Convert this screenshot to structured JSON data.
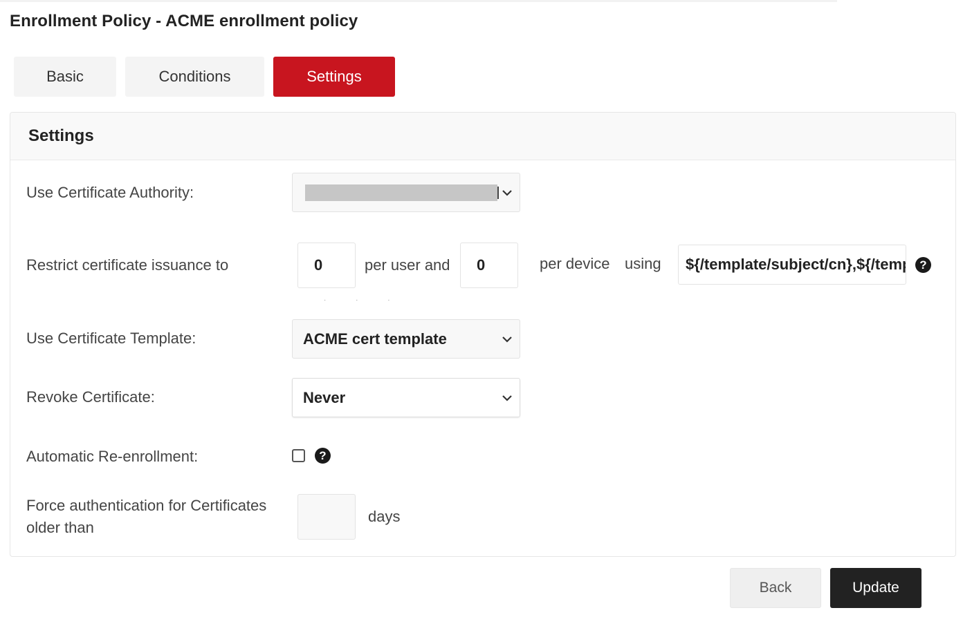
{
  "page": {
    "title": "Enrollment Policy - ACME enrollment policy"
  },
  "tabs": [
    {
      "label": "Basic",
      "active": false
    },
    {
      "label": "Conditions",
      "active": false
    },
    {
      "label": "Settings",
      "active": true
    }
  ],
  "colors": {
    "accent": "#c8151f",
    "dark_button": "#222222"
  },
  "settings": {
    "header": "Settings",
    "certificate_authority": {
      "label": "Use Certificate Authority:",
      "value": ""
    },
    "restrict": {
      "label": "Restrict certificate issuance to",
      "per_user_value": "0",
      "per_user_text": "per user and",
      "per_device_value": "0",
      "per_device_text": "per device",
      "using_text": "using",
      "template_value": "${/template/subject/cn},${/template/"
    },
    "certificate_template": {
      "label": "Use Certificate Template:",
      "value": "ACME cert template"
    },
    "revoke": {
      "label": "Revoke Certificate:",
      "value": "Never"
    },
    "reenrollment": {
      "label": "Automatic Re-enrollment:",
      "checked": false
    },
    "force_auth": {
      "label_line1": "Force authentication for Certificates",
      "label_line2": "older than",
      "value": "",
      "unit": "days"
    }
  },
  "actions": {
    "back_label": "Back",
    "update_label": "Update"
  },
  "icons": {
    "help": "?"
  }
}
